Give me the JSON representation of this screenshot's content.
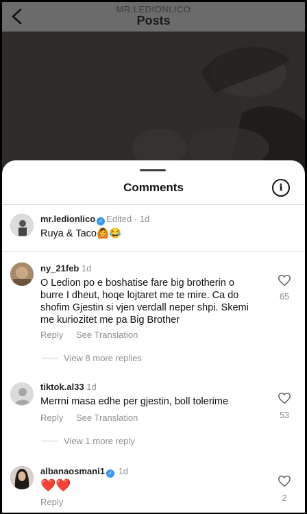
{
  "header": {
    "username": "MR.LEDIONLICO",
    "title": "Posts"
  },
  "sheet": {
    "title": "Comments"
  },
  "caption": {
    "username": "mr.ledionlico",
    "edited": "Edited",
    "time": "1d",
    "text": "Ruya & Taco",
    "emojis": "🙆😂"
  },
  "comments": [
    {
      "username": "ny_21feb",
      "time": "1d",
      "text": "O Ledion po e boshatise fare big brotherin o burre I dheut, hoqe lojtaret me te mire. Ca do shofim Gjestin si vjen verdall neper shpi. Skemi me kuriozitet me pa Big Brother",
      "reply": "Reply",
      "translate": "See Translation",
      "likes": "65",
      "view_replies": "View 8 more replies"
    },
    {
      "username": "tiktok.al33",
      "time": "1d",
      "text": "Merrni masa edhe per gjestin, boll tolerime",
      "reply": "Reply",
      "translate": "See Translation",
      "likes": "53",
      "view_replies": "View 1 more reply"
    },
    {
      "username": "albanaosmani1",
      "time": "1d",
      "text": "❤️❤️",
      "reply": "Reply",
      "likes": "2"
    }
  ],
  "icons": {
    "back": "chevron-left-icon",
    "info": "info-icon",
    "verified": "verified-badge-icon",
    "like": "heart-outline-icon"
  },
  "colors": {
    "verified": "#3897f0",
    "muted": "#8e8e8e"
  }
}
